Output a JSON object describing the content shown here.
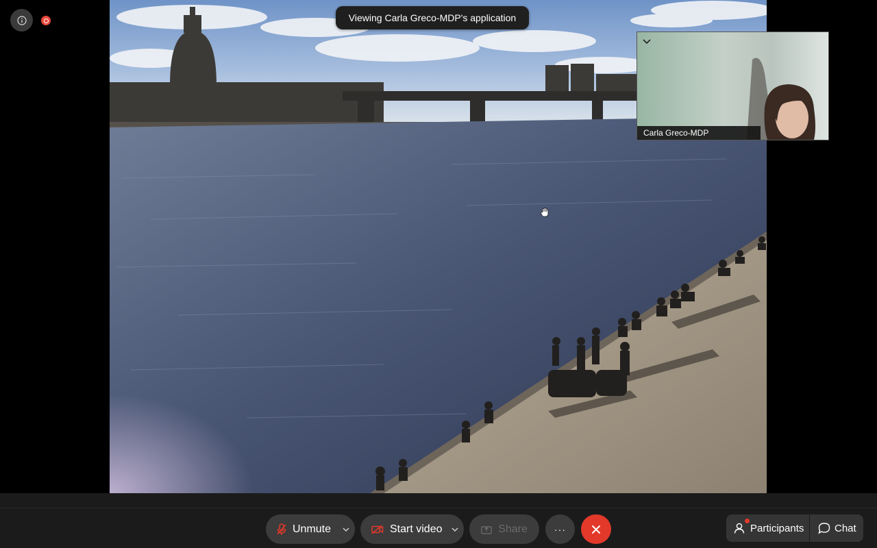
{
  "banner": {
    "text": "Viewing Carla Greco-MDP's application"
  },
  "video_tile": {
    "participant_name": "Carla Greco-MDP"
  },
  "controls": {
    "unmute_label": "Unmute",
    "start_video_label": "Start video",
    "share_label": "Share",
    "more_label": "···",
    "participants_label": "Participants",
    "chat_label": "Chat"
  },
  "icons": {
    "info": "info-icon",
    "recording": "recording-indicator-icon",
    "collapse": "chevron-down-icon",
    "mic_muted": "microphone-muted-icon",
    "camera_off": "camera-off-icon",
    "share": "share-icon",
    "end_call": "close-icon",
    "participants": "person-icon",
    "chat": "chat-bubble-icon"
  },
  "colors": {
    "end_call": "#e2392b",
    "recording": "#e8483b",
    "mic_muted": "#e2392b",
    "toolbar_bg": "#1b1b1b",
    "button_bg": "#3c3c3c"
  }
}
